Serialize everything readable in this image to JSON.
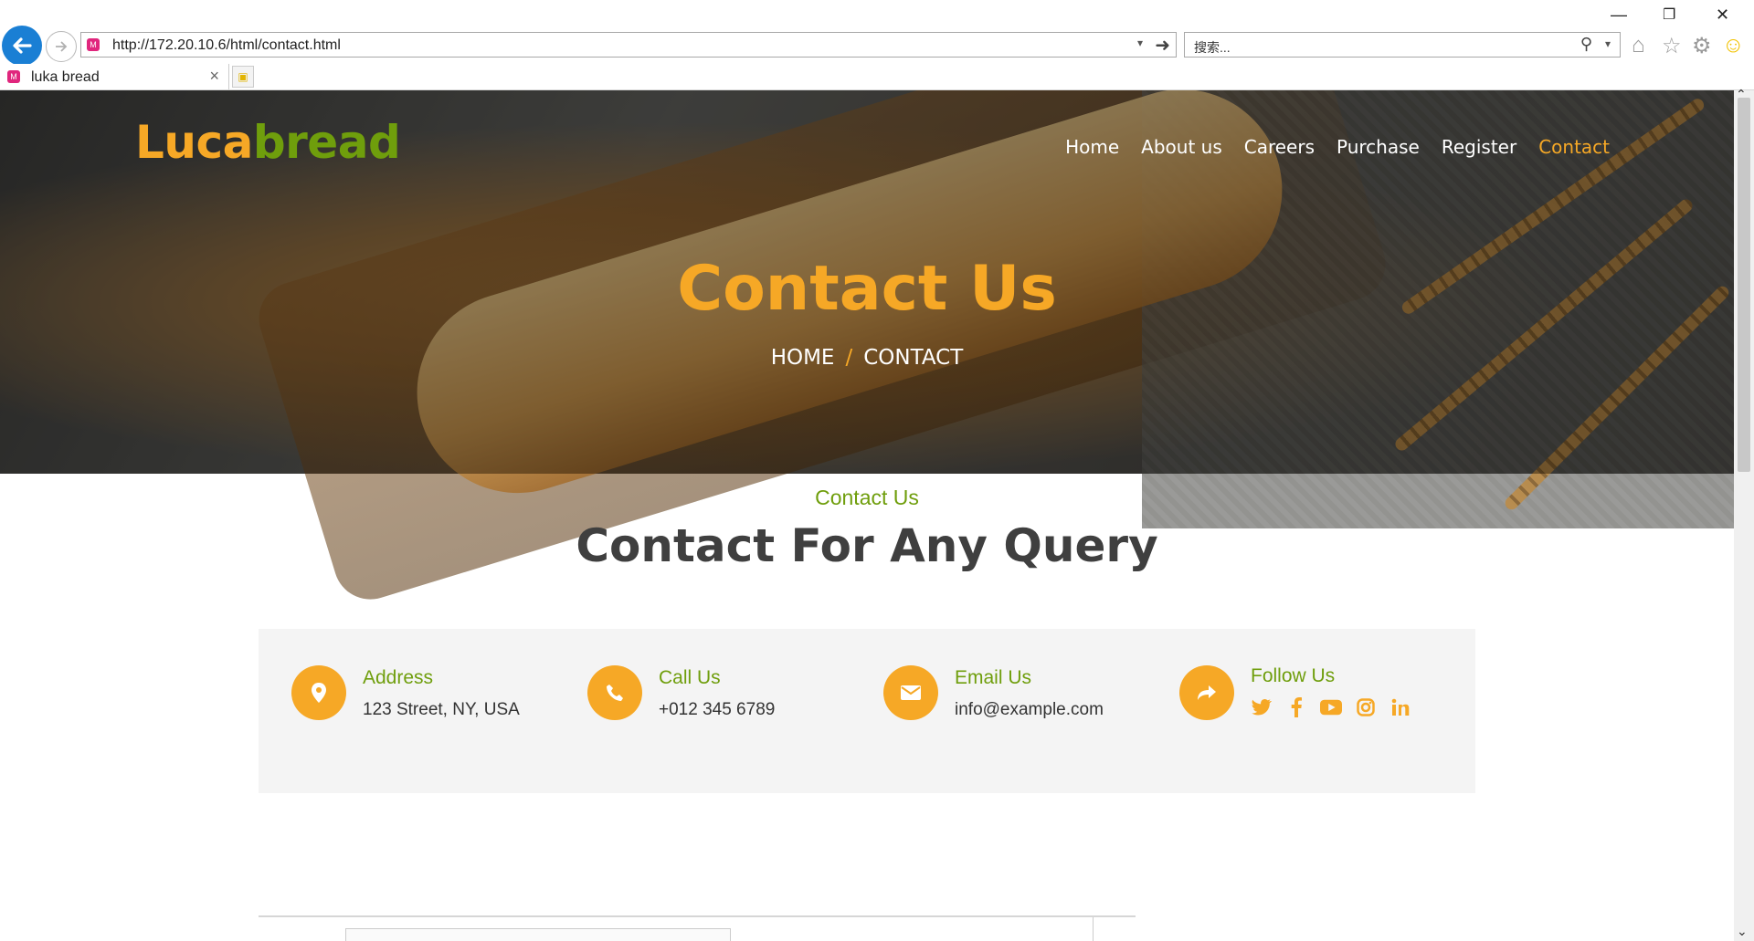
{
  "browser": {
    "url": "http://172.20.10.6/html/contact.html",
    "search_placeholder": "搜索...",
    "tab_title": "luka bread"
  },
  "site": {
    "logo_part1": "Luca",
    "logo_part2": "bread",
    "nav": [
      {
        "label": "Home",
        "active": false
      },
      {
        "label": "About us",
        "active": false
      },
      {
        "label": "Careers",
        "active": false
      },
      {
        "label": "Purchase",
        "active": false
      },
      {
        "label": "Register",
        "active": false
      },
      {
        "label": "Contact",
        "active": true
      }
    ]
  },
  "hero": {
    "title": "Contact Us",
    "crumb_home": "HOME",
    "crumb_sep": "/",
    "crumb_current": "CONTACT"
  },
  "section": {
    "subtitle": "Contact Us",
    "title": "Contact For Any Query"
  },
  "info": [
    {
      "label": "Address",
      "value": "123 Street, NY, USA",
      "icon": "map-pin-icon"
    },
    {
      "label": "Call Us",
      "value": "+012 345 6789",
      "icon": "phone-icon"
    },
    {
      "label": "Email Us",
      "value": "info@example.com",
      "icon": "envelope-icon"
    },
    {
      "label": "Follow Us",
      "icon": "share-icon",
      "socials": [
        "twitter-icon",
        "facebook-icon",
        "youtube-icon",
        "instagram-icon",
        "linkedin-icon"
      ]
    }
  ],
  "colors": {
    "accent_orange": "#f6a826",
    "accent_green": "#6f9e0c",
    "heading": "#3f3f3f",
    "info_bg": "#f4f4f4"
  }
}
